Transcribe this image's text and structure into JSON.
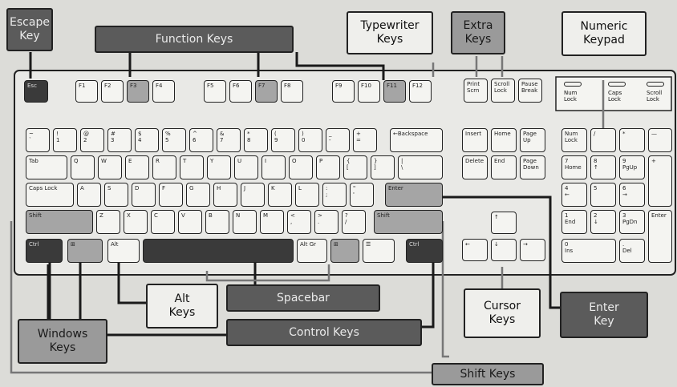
{
  "callouts": {
    "escape": "Escape\nKey",
    "function": "Function Keys",
    "typewriter": "Typewriter\nKeys",
    "extra": "Extra\nKeys",
    "numeric": "Numeric\nKeypad",
    "alt": "Alt\nKeys",
    "spacebar": "Spacebar",
    "windows": "Windows\nKeys",
    "control": "Control Keys",
    "cursor": "Cursor\nKeys",
    "enter": "Enter\nKey",
    "shift": "Shift Keys"
  },
  "keys": {
    "esc": "Esc",
    "f1": "F1",
    "f2": "F2",
    "f3": "F3",
    "f4": "F4",
    "f5": "F5",
    "f6": "F6",
    "f7": "F7",
    "f8": "F8",
    "f9": "F9",
    "f10": "F10",
    "f11": "F11",
    "f12": "F12",
    "print": "Print\nScrn",
    "scroll": "Scroll\nLock",
    "pause": "Pause\nBreak",
    "number_row": [
      "~\n`",
      "!\n1",
      "@\n2",
      "#\n3",
      "$\n4",
      "%\n5",
      "^\n6",
      "&\n7",
      "*\n8",
      "(\n9",
      ")\n0",
      "_\n-",
      "+\n="
    ],
    "backspace": "←Backspace",
    "tab": "Tab",
    "qrow": [
      "Q",
      "W",
      "E",
      "R",
      "T",
      "Y",
      "U",
      "I",
      "O",
      "P",
      "{\n[",
      "}\n]",
      "|\n\\"
    ],
    "caps": "Caps Lock",
    "arow": [
      "A",
      "S",
      "D",
      "F",
      "G",
      "H",
      "J",
      "K",
      "L",
      ":\n;",
      "\"\n'"
    ],
    "enter": "Enter",
    "shift": "Shift",
    "zrow": [
      "Z",
      "X",
      "C",
      "V",
      "B",
      "N",
      "M",
      "<\n,",
      ">\n.",
      "?\n/"
    ],
    "ctrl": "Ctrl",
    "alt": "Alt",
    "altgr": "Alt Gr",
    "insert": "Insert",
    "home": "Home",
    "pageup": "Page\nUp",
    "delete": "Delete",
    "end": "End",
    "pagedown": "Page\nDown",
    "up": "↑",
    "left": "←",
    "down": "↓",
    "right": "→",
    "numlock": "Num\nLock",
    "slash": "/",
    "star": "*",
    "minus": "—",
    "n7": "7\nHome",
    "n8": "8\n↑",
    "n9": "9\nPgUp",
    "plus": "+",
    "n4": "4\n←",
    "n5": "5",
    "n6": "6\n→",
    "n1": "1\nEnd",
    "n2": "2\n↓",
    "n3": "3\nPgDn",
    "numenter": "Enter",
    "n0": "0\nIns",
    "ndot": ".\nDel"
  },
  "leds": [
    "Num\nLock",
    "Caps\nLock",
    "Scroll\nLock"
  ]
}
